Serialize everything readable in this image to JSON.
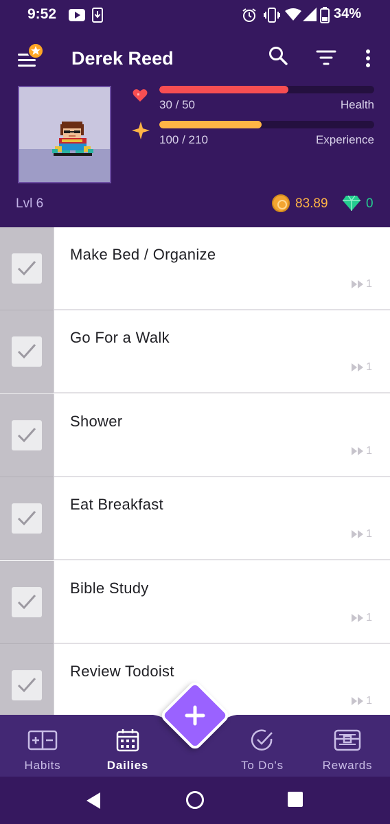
{
  "status_bar": {
    "time": "9:52",
    "battery": "34%",
    "icons": [
      "youtube-icon",
      "download-icon",
      "alarm-icon",
      "vibrate-icon",
      "wifi-icon",
      "signal-icon",
      "battery-icon"
    ]
  },
  "header": {
    "username": "Derek Reed",
    "icons": [
      "menu-icon",
      "search-icon",
      "filter-icon",
      "more-vert-icon"
    ],
    "health": {
      "value_text": "30 / 50",
      "label": "Health",
      "fraction": 0.6,
      "color": "#f74e52"
    },
    "experience": {
      "value_text": "100 / 210",
      "label": "Experience",
      "fraction": 0.476,
      "color": "#ffb445"
    },
    "level": "Lvl 6",
    "gold": "83.89",
    "gems": "0"
  },
  "tasks": [
    {
      "title": "Make Bed / Organize",
      "streak": "1"
    },
    {
      "title": "Go For a Walk",
      "streak": "1"
    },
    {
      "title": "Shower",
      "streak": "1"
    },
    {
      "title": "Eat Breakfast",
      "streak": "1"
    },
    {
      "title": "Bible Study",
      "streak": "1"
    },
    {
      "title": "Review Todoist",
      "streak": "1"
    }
  ],
  "bottom_nav": {
    "items": [
      {
        "label": "Habits",
        "icon": "habits-icon"
      },
      {
        "label": "Dailies",
        "icon": "calendar-icon",
        "active": true
      },
      {
        "label": "To Do's",
        "icon": "check-circle-icon"
      },
      {
        "label": "Rewards",
        "icon": "chest-icon"
      }
    ]
  },
  "colors": {
    "header_bg": "#36185f",
    "nav_bg": "#432874",
    "fab": "#9a62ff",
    "gold": "#ffb445",
    "gem": "#24cc8f"
  }
}
